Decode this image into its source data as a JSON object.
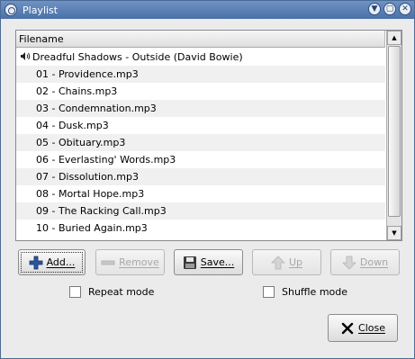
{
  "window": {
    "title": "Playlist"
  },
  "list": {
    "column_header": "Filename",
    "album": "Dreadful Shadows - Outside (David Bowie)",
    "tracks": [
      "01 - Providence.mp3",
      "02 - Chains.mp3",
      "03 - Condemnation.mp3",
      "04 - Dusk.mp3",
      "05 - Obituary.mp3",
      "06 - Everlasting' Words.mp3",
      "07 - Dissolution.mp3",
      "08 - Mortal Hope.mp3",
      "09 - The Racking Call.mp3",
      "10 - Buried Again.mp3"
    ]
  },
  "buttons": {
    "add": "Add...",
    "remove": "Remove",
    "save": "Save...",
    "up": "Up",
    "down": "Down",
    "close": "Close"
  },
  "options": {
    "repeat": "Repeat mode",
    "shuffle": "Shuffle mode",
    "repeat_checked": false,
    "shuffle_checked": false
  },
  "colors": {
    "titlebar": "#4a71a8",
    "add_icon": "#2a55a0",
    "close_icon": "#000000"
  }
}
